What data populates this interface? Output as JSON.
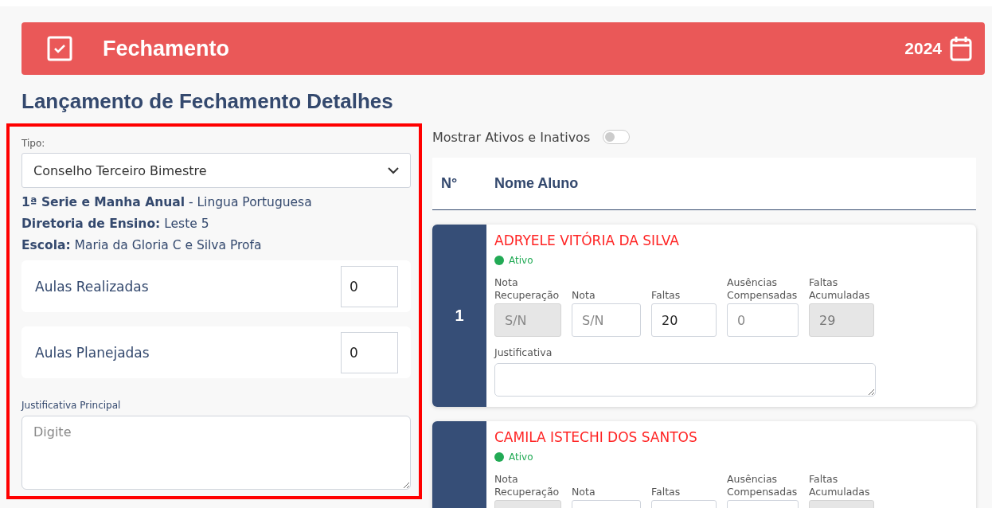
{
  "header": {
    "title": "Fechamento",
    "year": "2024"
  },
  "page_title": "Lançamento de Fechamento Detalhes",
  "left_panel": {
    "highlighted": true,
    "type_field": {
      "label": "Tipo:",
      "value": "Conselho Terceiro Bimestre"
    },
    "info": [
      "**1ª Serie e Manha Anual** - Lingua Portuguesa",
      "**Diretoria de Ensino:** Leste 5",
      "**Escola:** Maria da Gloria C e Silva Profa"
    ],
    "counters": [
      {
        "label": "Aulas Realizadas",
        "value": "0"
      },
      {
        "label": "Aulas Planejadas",
        "value": "0"
      }
    ],
    "justification": {
      "label": "Justificativa Principal",
      "placeholder": "Digite"
    }
  },
  "toggle": {
    "label": "Mostrar Ativos e Inativos",
    "on": false
  },
  "table": {
    "columns": [
      "N°",
      "Nome Aluno"
    ]
  },
  "students": [
    {
      "number": "1",
      "name": "ADRYELE VITÓRIA DA SILVA",
      "status": "Ativo",
      "active": true,
      "justification_label": "Justificativa",
      "fields": [
        {
          "label": "Nota Recuperação",
          "placeholder": "S/N",
          "disabled": true
        },
        {
          "label": "Nota",
          "placeholder": "S/N",
          "disabled": false
        },
        {
          "label": "Faltas",
          "value": "20",
          "disabled": false
        },
        {
          "label": "Ausências Compensadas",
          "placeholder": "0",
          "disabled": false
        },
        {
          "label": "Faltas Acumuladas",
          "value": "29",
          "disabled": true
        }
      ]
    },
    {
      "name": "CAMILA ISTECHI DOS SANTOS",
      "status": "Ativo",
      "active": true,
      "fields": [
        {
          "label": "Nota Recuperação",
          "disabled": true
        },
        {
          "label": "Nota",
          "disabled": false
        },
        {
          "label": "Faltas",
          "disabled": false
        },
        {
          "label": "Ausências Compensadas",
          "disabled": false
        },
        {
          "label": "Faltas Acumuladas",
          "disabled": true
        }
      ]
    }
  ]
}
